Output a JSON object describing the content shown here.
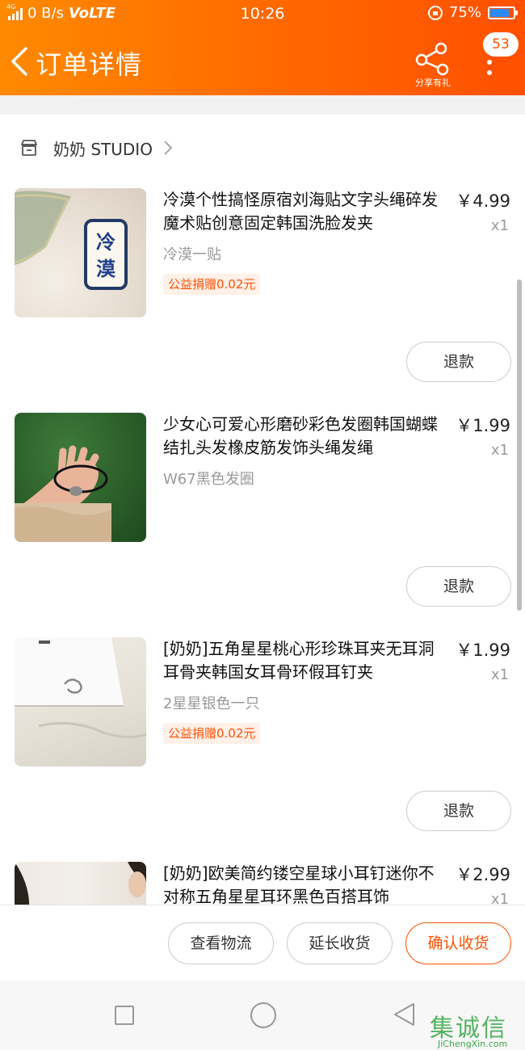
{
  "status_bar": {
    "network_type": "4G",
    "speed": "0 B/s",
    "volte": "VoLTE",
    "time": "10:26",
    "battery": "75%",
    "battery_level": 0.75,
    "battery_color": "#2b8bf7"
  },
  "header": {
    "title": "订单详情",
    "share_label": "分享有礼",
    "message_count": "53",
    "gradient": [
      "#ff8a00",
      "#ff4f00"
    ]
  },
  "shop": {
    "name": "奶奶 STUDIO",
    "icon": "store-icon"
  },
  "items": [
    {
      "title": "冷漠个性搞怪原宿刘海贴文字头绳碎发魔术贴创意固定韩国洗脸发夹",
      "price": "￥4.99",
      "qty": "x1",
      "sku": "冷漠一贴",
      "charity": "公益捐赠0.02元",
      "refund_label": "退款",
      "thumb_text": "冷漠"
    },
    {
      "title": "少女心可爱心形磨砂彩色发圈韩国蝴蝶结扎头发橡皮筋发饰头绳发绳",
      "price": "￥1.99",
      "qty": "x1",
      "sku": "W67黑色发圈",
      "charity": "",
      "refund_label": "退款"
    },
    {
      "title": "[奶奶]五角星星桃心形珍珠耳夹无耳洞耳骨夹韩国女耳骨环假耳钉夹",
      "price": "￥1.99",
      "qty": "x1",
      "sku": "2星星银色一只",
      "charity": "公益捐赠0.02元",
      "refund_label": "退款"
    },
    {
      "title": "[奶奶]欧美简约镂空星球小耳钉迷你不对称五角星星耳环黑色百搭耳饰",
      "price": "￥2.99",
      "qty": "x1",
      "sku": "",
      "charity": "",
      "refund_label": "退款"
    }
  ],
  "bottom_actions": {
    "logistics": "查看物流",
    "extend": "延长收货",
    "confirm": "确认收货",
    "accent": "#ff5000"
  },
  "watermark": {
    "cn": "集诚信",
    "en": "JiChengXin.com"
  }
}
